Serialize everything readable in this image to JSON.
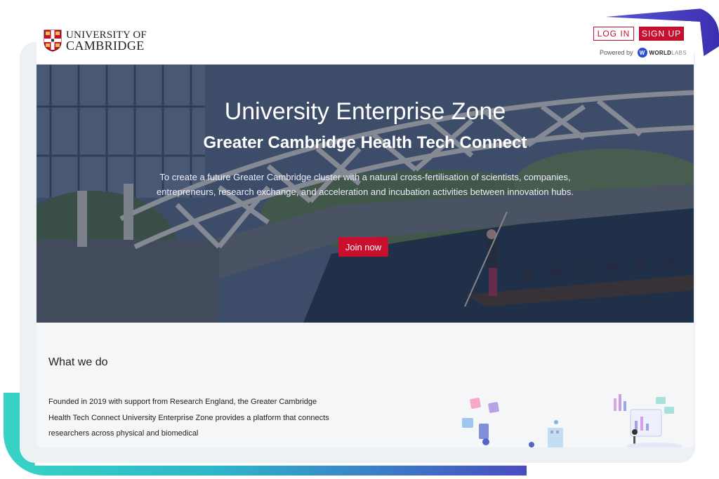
{
  "header": {
    "logo": {
      "line1": "UNIVERSITY OF",
      "line2": "CAMBRIDGE"
    },
    "login_label": "LOG IN",
    "signup_label": "SIGN UP",
    "powered_by": "Powered by",
    "powered_brand": "WORLD",
    "powered_brand_suffix": "LABS"
  },
  "hero": {
    "title": "University Enterprise Zone",
    "subtitle": "Greater Cambridge Health Tech Connect",
    "description": "To create a future Greater Cambridge cluster with a natural cross-fertilisation of scientists, companies, entrepreneurs, research exchange, and acceleration and incubation activities between innovation hubs.",
    "cta_label": "Join now"
  },
  "section": {
    "title": "What we do",
    "text": "Founded in 2019 with support from Research England, the Greater Cambridge Health Tech Connect University Enterprise Zone provides a platform that connects researchers across physical and biomedical"
  },
  "colors": {
    "brand_red": "#c8102e",
    "accent_teal": "#38d3c5",
    "accent_indigo": "#4a4cc0"
  }
}
